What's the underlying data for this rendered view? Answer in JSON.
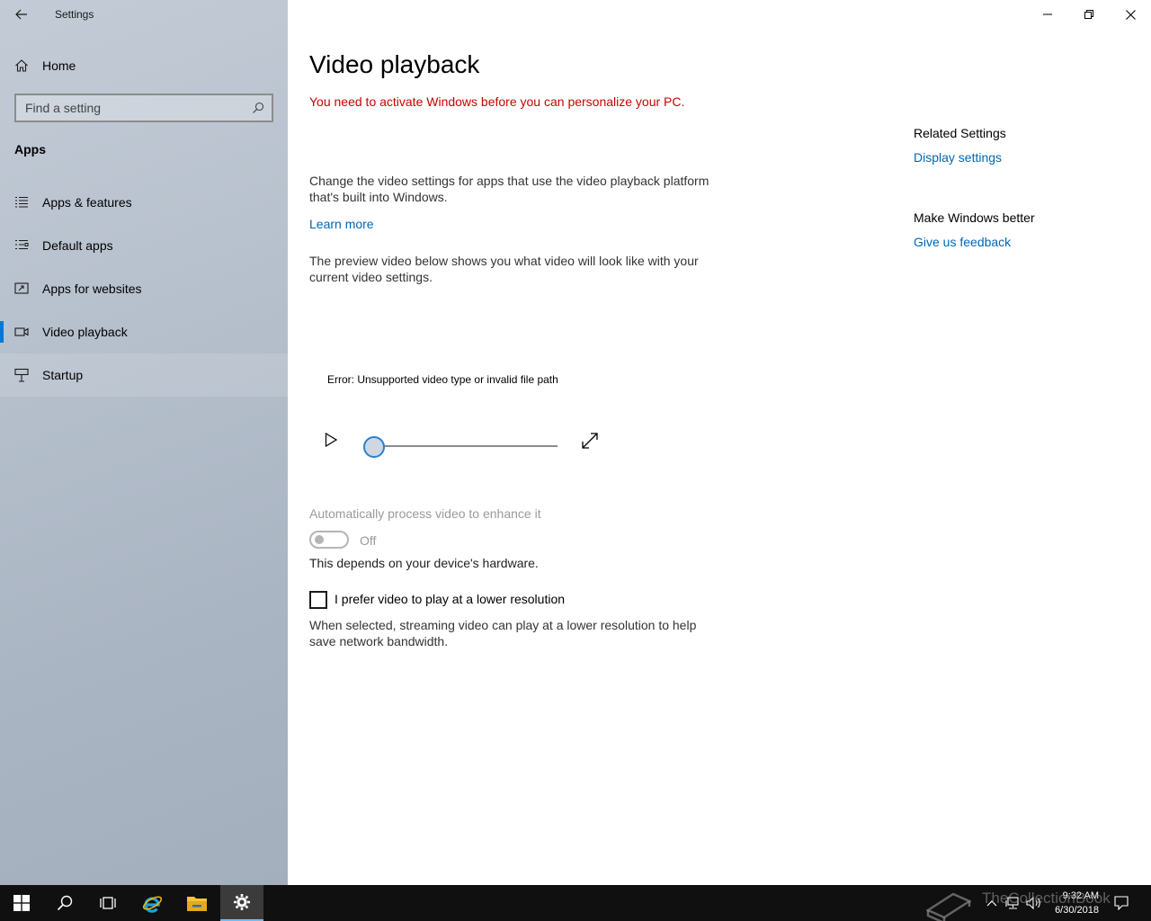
{
  "window": {
    "app_title": "Settings",
    "controls": [
      "minimize-icon",
      "restore-icon",
      "close-icon"
    ]
  },
  "sidebar": {
    "home_label": "Home",
    "search": {
      "placeholder": "Find a setting",
      "value": ""
    },
    "section_header": "Apps",
    "items": [
      {
        "label": "Apps & features",
        "icon": "list-icon",
        "selected": false
      },
      {
        "label": "Default apps",
        "icon": "default-apps-icon",
        "selected": false
      },
      {
        "label": "Apps for websites",
        "icon": "apps-for-websites-icon",
        "selected": false
      },
      {
        "label": "Video playback",
        "icon": "video-camera-icon",
        "selected": true
      },
      {
        "label": "Startup",
        "icon": "startup-icon",
        "selected": false
      }
    ]
  },
  "main": {
    "title": "Video playback",
    "activation_warning": "You need to activate Windows before you can personalize your PC.",
    "description_line1": "Change the video settings for apps that use the video playback platform",
    "description_line2": "that's built into Windows.",
    "learn_more": "Learn more",
    "preview_line1": "The preview video below shows you what video will look like with your",
    "preview_line2": "current video settings.",
    "video": {
      "error": "Error: Unsupported video type or invalid file path",
      "progress": 0
    },
    "auto_process": {
      "label": "Automatically process video to enhance it",
      "state": "Off",
      "note": "This depends on your device's hardware."
    },
    "lower_res": {
      "label": "I prefer video to play at a lower resolution",
      "checked": false,
      "note_line1": "When selected, streaming video can play at a lower resolution to help",
      "note_line2": "save network bandwidth."
    }
  },
  "related": {
    "header": "Related Settings",
    "display_link": "Display settings",
    "better_header": "Make Windows better",
    "feedback_link": "Give us feedback"
  },
  "taskbar": {
    "time": "9:32 AM",
    "date": "6/30/2018",
    "watermark": "TheCollectionBook"
  },
  "colors": {
    "accent": "#0078d7",
    "link": "#0066b4",
    "warning": "#c50500",
    "taskbar": "#101010"
  }
}
